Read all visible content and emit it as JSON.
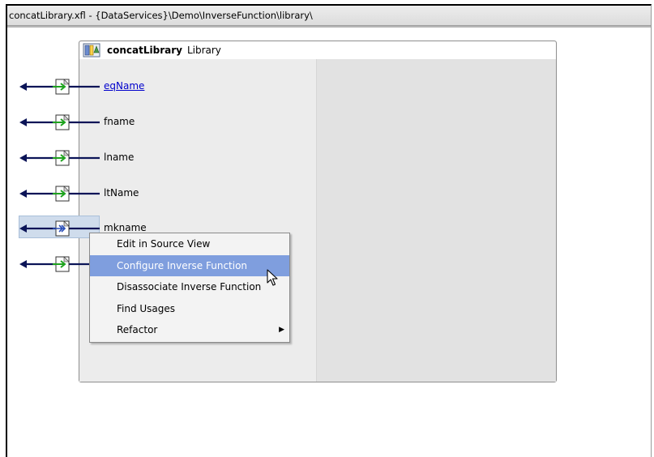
{
  "editor": {
    "tab_title": "concatLibrary.xfl - {DataServices}\\Demo\\InverseFunction\\library\\"
  },
  "library": {
    "name": "concatLibrary",
    "kind": "Library",
    "icon": "library-icon"
  },
  "functions": [
    {
      "name": "eqName",
      "style": "link",
      "icon": "function-arrow-icon"
    },
    {
      "name": "fname",
      "style": "normal",
      "icon": "function-arrow-icon"
    },
    {
      "name": "lname",
      "style": "normal",
      "icon": "function-arrow-icon"
    },
    {
      "name": "ltName",
      "style": "normal",
      "icon": "function-arrow-icon"
    },
    {
      "name": "mkname",
      "style": "selected",
      "icon": "inverse-function-arrow-icon"
    },
    {
      "name": "",
      "style": "normal",
      "icon": "function-arrow-icon"
    }
  ],
  "context_menu": {
    "items": [
      {
        "label": "Edit in Source View"
      },
      {
        "label": "Configure Inverse Function",
        "highlighted": true
      },
      {
        "label": "Disassociate Inverse Function"
      },
      {
        "label": "Find Usages"
      },
      {
        "label": "Refactor",
        "submenu": true
      }
    ]
  },
  "colors": {
    "arrow": "#0b1457",
    "arrow_icon_green": "#1ea31e",
    "menu_highlight": "#7f9ede",
    "selection": "#cfdcec"
  }
}
